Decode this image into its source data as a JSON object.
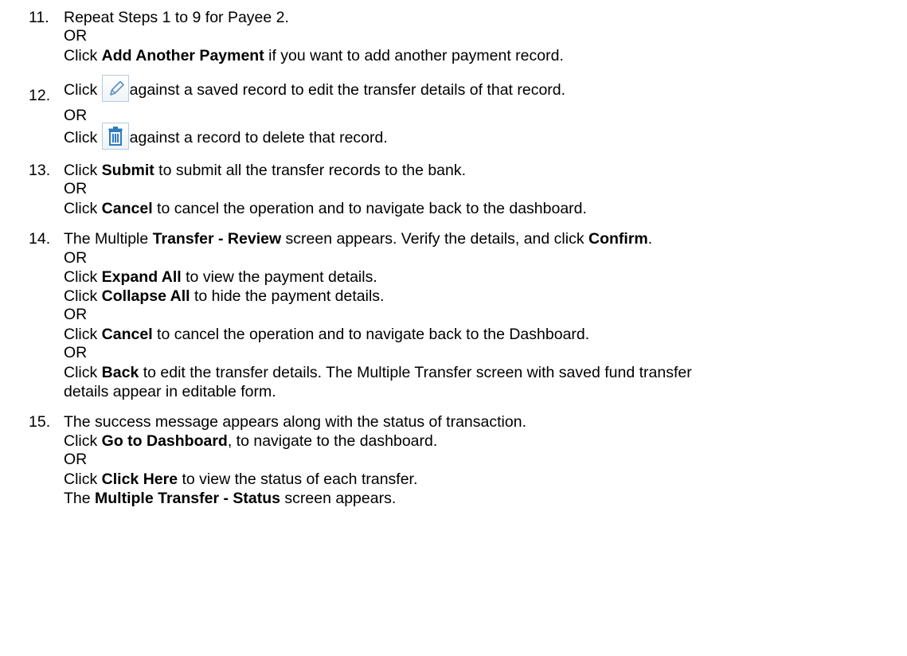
{
  "steps": [
    {
      "number": "11.",
      "l1_text": "Repeat Steps 1 to 9 for Payee 2.",
      "l2_text": "OR",
      "l3_pre": "Click ",
      "l3_bold": "Add Another Payment",
      "l3_post": " if you want to add another payment record."
    },
    {
      "number": "12.",
      "l1_pre": "Click ",
      "l1_icon": "pencil-edit-icon",
      "l1_post": "against a saved record to edit the transfer details of that record.",
      "l2_text": "OR",
      "l3_pre": "Click ",
      "l3_icon": "trash-delete-icon",
      "l3_post": "against a record to delete that record."
    },
    {
      "number": "13.",
      "l1_pre": "Click ",
      "l1_bold": "Submit",
      "l1_post": " to submit all the transfer records to the bank.",
      "l2_text": "OR",
      "l3_pre": "Click ",
      "l3_bold": "Cancel",
      "l3_post": " to cancel the operation and to navigate back to the dashboard."
    },
    {
      "number": "14.",
      "l1_pre": "The Multiple ",
      "l1_bold": "Transfer - Review",
      "l1_mid": " screen appears. Verify the details, and click ",
      "l1_bold2": "Confirm",
      "l1_post": ".",
      "l2_text": "OR",
      "l3_pre": "Click ",
      "l3_bold": "Expand All",
      "l3_post": " to view the payment details.",
      "l4_pre": "Click ",
      "l4_bold": "Collapse All",
      "l4_post": " to hide the payment details.",
      "l5_text": "OR",
      "l6_pre": "Click ",
      "l6_bold": "Cancel",
      "l6_post": " to cancel the operation and to navigate back to the Dashboard.",
      "l7_text": "OR",
      "l8_pre": "Click ",
      "l8_bold": "Back",
      "l8_post": " to edit the transfer details. The Multiple Transfer screen with saved fund transfer",
      "l9_text": "details appear in editable form."
    },
    {
      "number": "15.",
      "l1_text": "The success message appears along with the status of transaction.",
      "l2_pre": "Click ",
      "l2_bold": "Go to Dashboard",
      "l2_post": ", to navigate to the dashboard.",
      "l3_text": "OR",
      "l4_pre": "Click ",
      "l4_bold": "Click Here",
      "l4_post": " to view the status of each transfer.",
      "l5_pre": "The ",
      "l5_bold": "Multiple Transfer - Status",
      "l5_post": " screen appears."
    }
  ],
  "colors": {
    "icon_stroke": "#5b8fc0",
    "icon_border": "#b9cbdc"
  }
}
